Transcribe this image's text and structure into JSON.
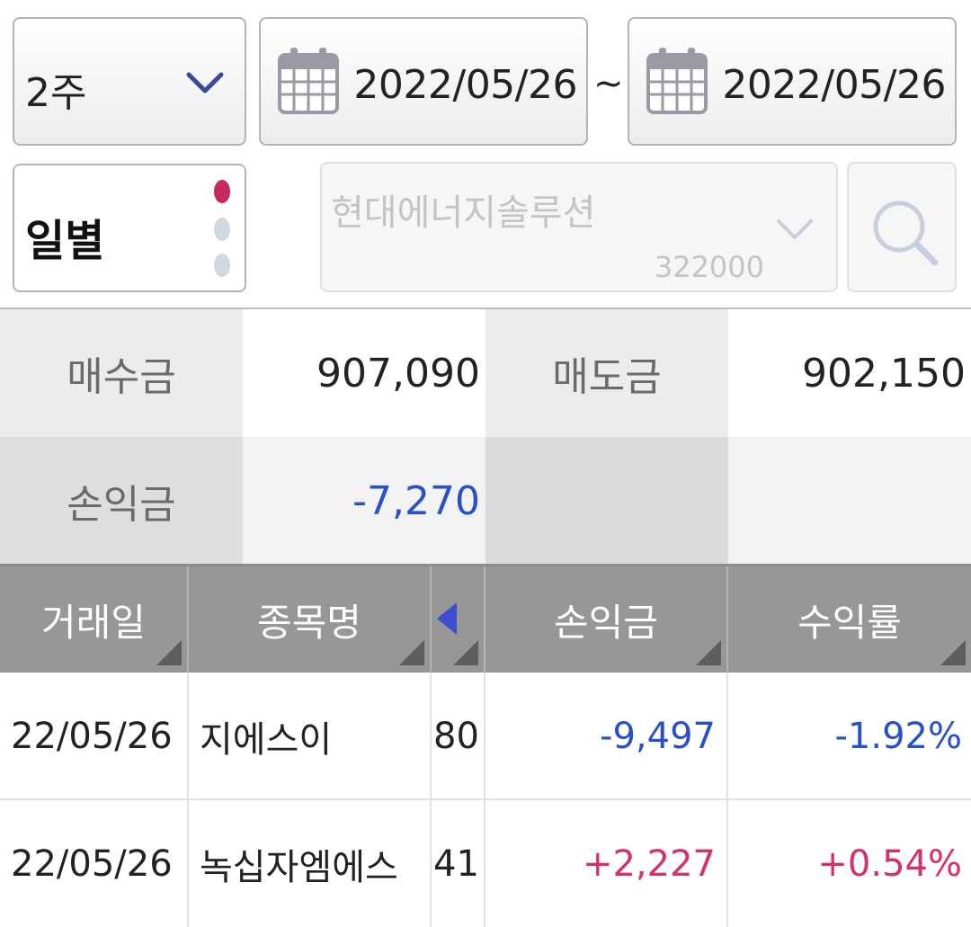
{
  "filters": {
    "period_label": "2주",
    "start_date": "2022/05/26",
    "separator": "~",
    "end_date": "2022/05/26",
    "mode_label": "일별",
    "stock_name": "현대에너지솔루션",
    "stock_code": "322000"
  },
  "summary": {
    "buy_label": "매수금",
    "buy_value": "907,090",
    "sell_label": "매도금",
    "sell_value": "902,150",
    "pnl_label": "손익금",
    "pnl_value": "-7,270"
  },
  "table": {
    "headers": [
      "거래일",
      "종목명",
      "손익금",
      "수익률"
    ],
    "rows": [
      {
        "date": "22/05/26",
        "name": "지에스이",
        "qty": "80",
        "pnl": "-9,497",
        "rate": "-1.92%"
      },
      {
        "date": "22/05/26",
        "name": "녹십자엠에스",
        "qty": "41",
        "pnl": "+2,227",
        "rate": "+0.54%"
      }
    ]
  },
  "colors": {
    "negative": "#2850c8",
    "positive": "#d63068",
    "header_bg": "#979797"
  }
}
